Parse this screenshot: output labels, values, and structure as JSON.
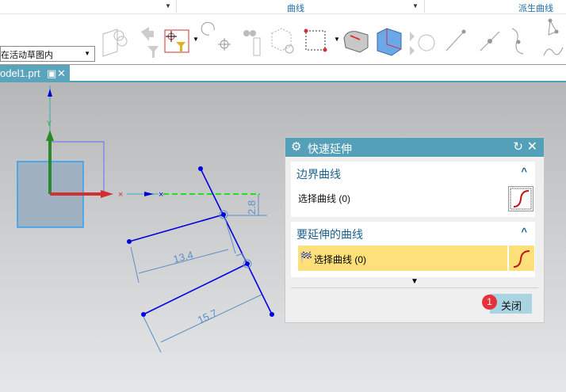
{
  "ribbon": {
    "groups": [
      {
        "label": ""
      },
      {
        "label": "曲线"
      },
      {
        "label": "派生曲线"
      }
    ]
  },
  "toolbar": {
    "selection_scope": "在活动草图内",
    "tools": [
      "associative-curve",
      "undo-filter",
      "select-filter",
      "reset",
      "binoculars",
      "cube-snap",
      "rect-select",
      "extrude-face",
      "solid-cube",
      "arrows-move",
      "line",
      "point-on-line",
      "curve",
      "spline-points",
      "spline"
    ]
  },
  "tab": {
    "label": "odel1.prt"
  },
  "sketch": {
    "dimensions": [
      "2.8",
      "13.4",
      "15.7"
    ],
    "colors": {
      "curve": "#0000e0",
      "dim": "#5b8fc8",
      "axis_x": "#d03030",
      "axis_y": "#2a8a2a"
    }
  },
  "dialog": {
    "title": "快速延伸",
    "section1": {
      "title": "边界曲线",
      "row": "选择曲线 (0)"
    },
    "section2": {
      "title": "要延伸的曲线",
      "row": "选择曲线 (0)"
    },
    "close_label": "关闭",
    "badge": "1",
    "highlight": "#fde07a"
  }
}
